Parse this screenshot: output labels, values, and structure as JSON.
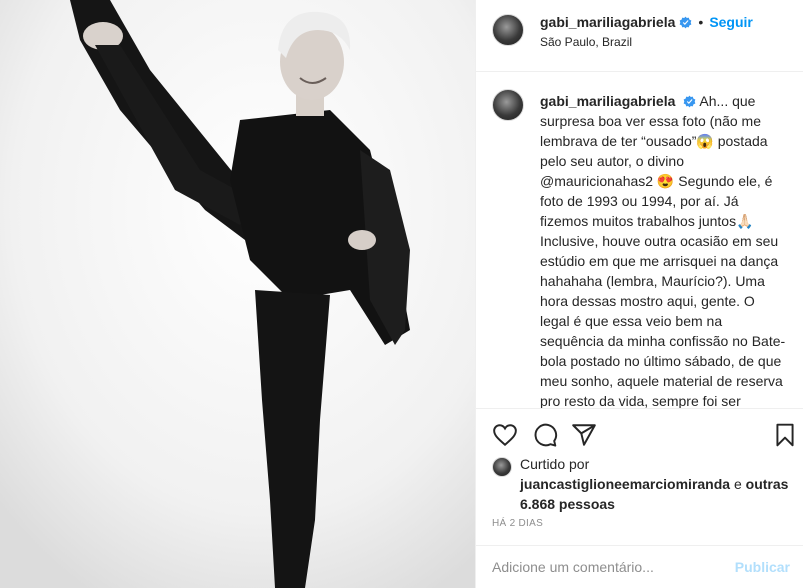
{
  "post": {
    "username": "gabi_mariliagabriela",
    "verified_icon": "verified-badge-icon",
    "follow_label": "Seguir",
    "location": "São Paulo, Brazil"
  },
  "caption": {
    "username": "gabi_mariliagabriela",
    "text": "Ah... que surpresa boa ver essa foto (não me lembrava de ter “ousado”😱 postada pelo seu autor, o divino @mauricionahas2 😍 Segundo ele, é foto de 1993 ou 1994, por aí. Já fizemos muitos trabalhos juntos🙏🏻 Inclusive, houve outra ocasião em seu estúdio em que me arrisquei na dança hahahaha (lembra, Maurício?). Uma hora dessas mostro aqui, gente. O legal é que essa veio bem na sequência da minha confissão no Bate-bola postado no último sábado, de que meu sonho, aquele material de reserva pro resto da vida, sempre foi ser bailarina! 😳◻😂😂😂 Boa quarta, turma querida. Beijo sobre"
  },
  "actions": {
    "like_icon": "heart-icon",
    "comment_icon": "comment-icon",
    "share_icon": "share-icon",
    "save_icon": "bookmark-icon"
  },
  "likes": {
    "prefix": "Curtido por",
    "user": "juancastiglioneemarciomiranda",
    "joiner": "e",
    "others": "outras 6.868 pessoas"
  },
  "timestamp": "HÁ 2 DIAS",
  "comment": {
    "placeholder": "Adicione um comentário...",
    "publish_label": "Publicar"
  },
  "colors": {
    "accent": "#0095f6",
    "publish_disabled": "#b2dffc",
    "muted": "#8e8e8e",
    "divider": "#efefef"
  }
}
